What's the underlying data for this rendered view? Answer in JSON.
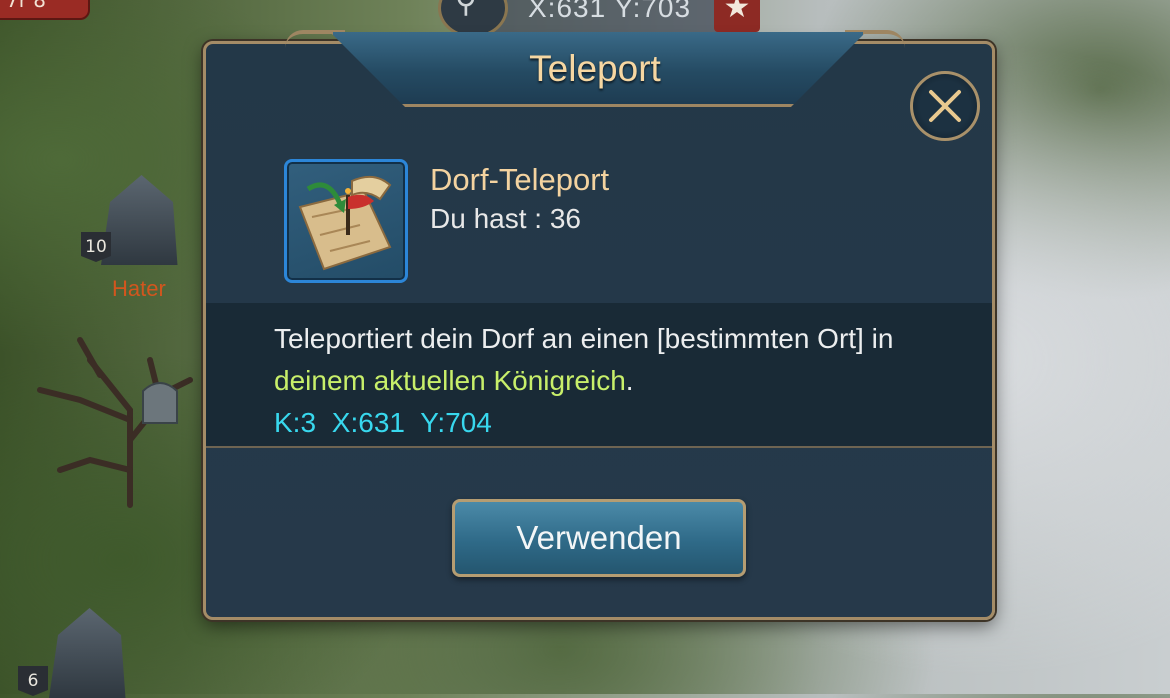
{
  "map": {
    "search_icon": "magnifier-icon",
    "coordinates": "X:631  Y:703",
    "favorite_icon": "star-icon",
    "corner_tag": "7r 8",
    "buildings": [
      {
        "level": "10",
        "name": "Hater"
      },
      {
        "level": "6",
        "name": ""
      }
    ]
  },
  "dialog": {
    "title": "Teleport",
    "close_icon": "close-x-icon",
    "item": {
      "icon": "scroll-map-flag-icon",
      "name": "Dorf-Teleport",
      "count_text": "Du hast : 36"
    },
    "description": {
      "part1": "Teleportiert dein Dorf an einen [bestimmten Ort] in ",
      "highlight": "deinem aktuellen Königreich",
      "part2": ".",
      "coords": "K:3  X:631  Y:704"
    },
    "use_button": "Verwenden",
    "colors": {
      "title": "#f6d7a2",
      "highlight": "#c8ef6a",
      "coords": "#38d8ee",
      "border": "#a48c67"
    }
  }
}
